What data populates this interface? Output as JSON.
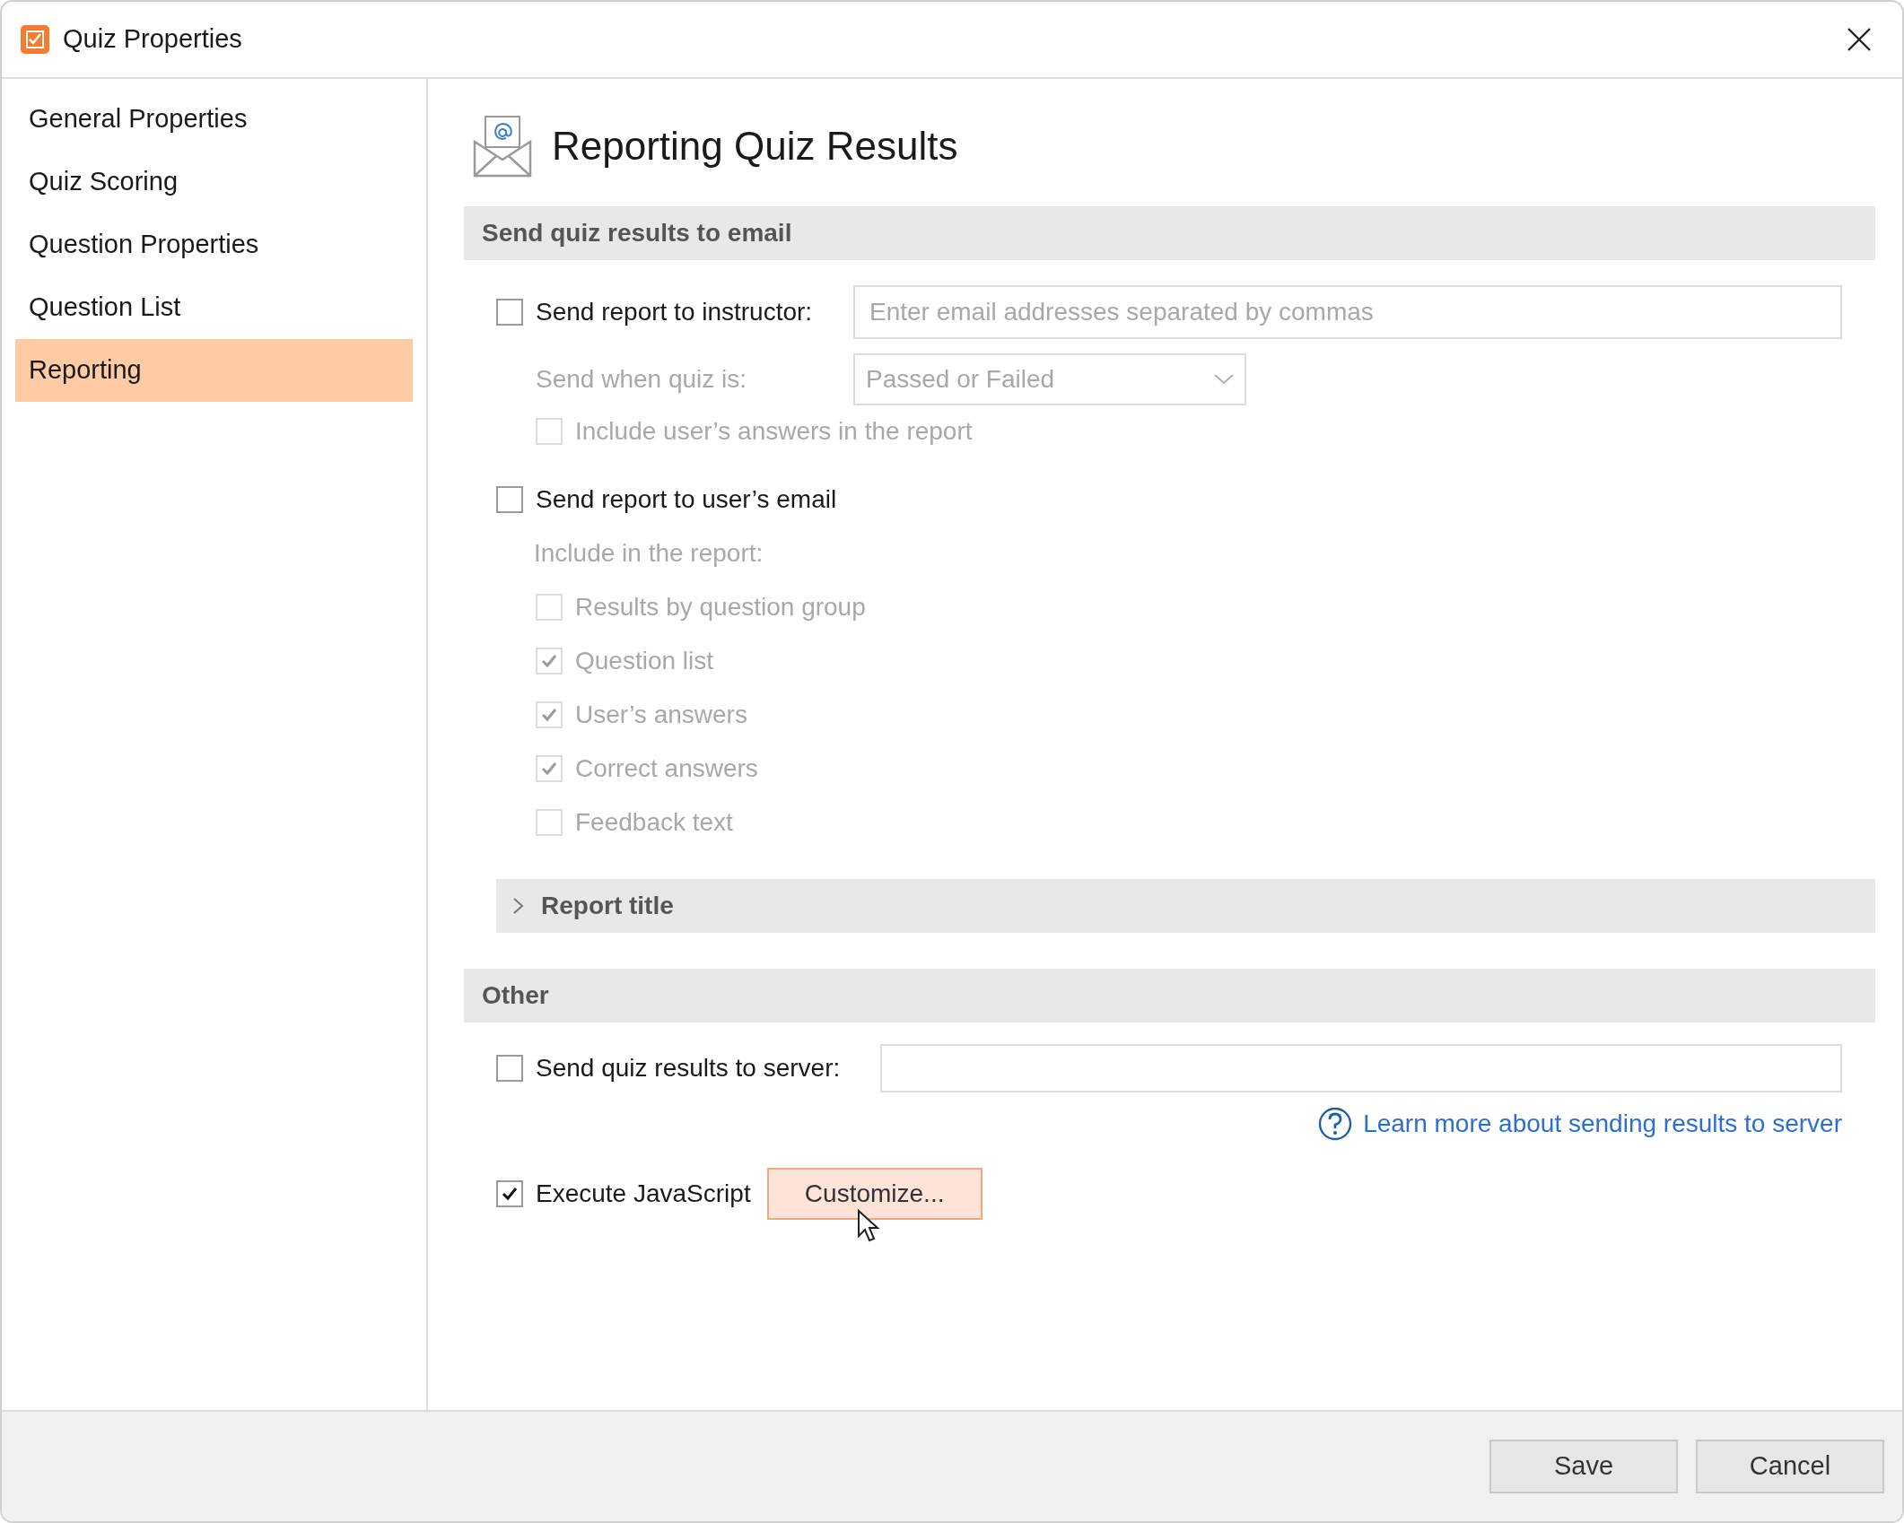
{
  "window": {
    "title": "Quiz Properties"
  },
  "sidebar": {
    "items": [
      {
        "label": "General Properties",
        "selected": false
      },
      {
        "label": "Quiz Scoring",
        "selected": false
      },
      {
        "label": "Question Properties",
        "selected": false
      },
      {
        "label": "Question List",
        "selected": false
      },
      {
        "label": "Reporting",
        "selected": true
      }
    ]
  },
  "page": {
    "title": "Reporting Quiz Results"
  },
  "email_section": {
    "title": "Send quiz results to email",
    "instructor": {
      "label": "Send report to instructor:",
      "checked": false,
      "placeholder": "Enter email addresses separated by commas"
    },
    "send_when": {
      "label": "Send when quiz is:",
      "value": "Passed or Failed",
      "disabled": true
    },
    "include_answers": {
      "label": "Include user’s answers in the report",
      "checked": false,
      "disabled": true
    },
    "user_email": {
      "label": "Send report to user’s email",
      "checked": false
    },
    "include_label": "Include in the report:",
    "include_options": [
      {
        "label": "Results by question group",
        "checked": false,
        "disabled": true
      },
      {
        "label": "Question list",
        "checked": true,
        "disabled": true
      },
      {
        "label": "User’s answers",
        "checked": true,
        "disabled": true
      },
      {
        "label": "Correct answers",
        "checked": true,
        "disabled": true
      },
      {
        "label": "Feedback text",
        "checked": false,
        "disabled": true
      }
    ],
    "report_title": {
      "label": "Report title",
      "expanded": false
    }
  },
  "other_section": {
    "title": "Other",
    "server": {
      "label": "Send quiz results to server:",
      "checked": false
    },
    "learn_more": "Learn more about sending results to server",
    "javascript": {
      "label": "Execute JavaScript",
      "checked": true
    },
    "customize_button": "Customize..."
  },
  "footer": {
    "buttons": [
      "Save",
      "Cancel"
    ]
  }
}
